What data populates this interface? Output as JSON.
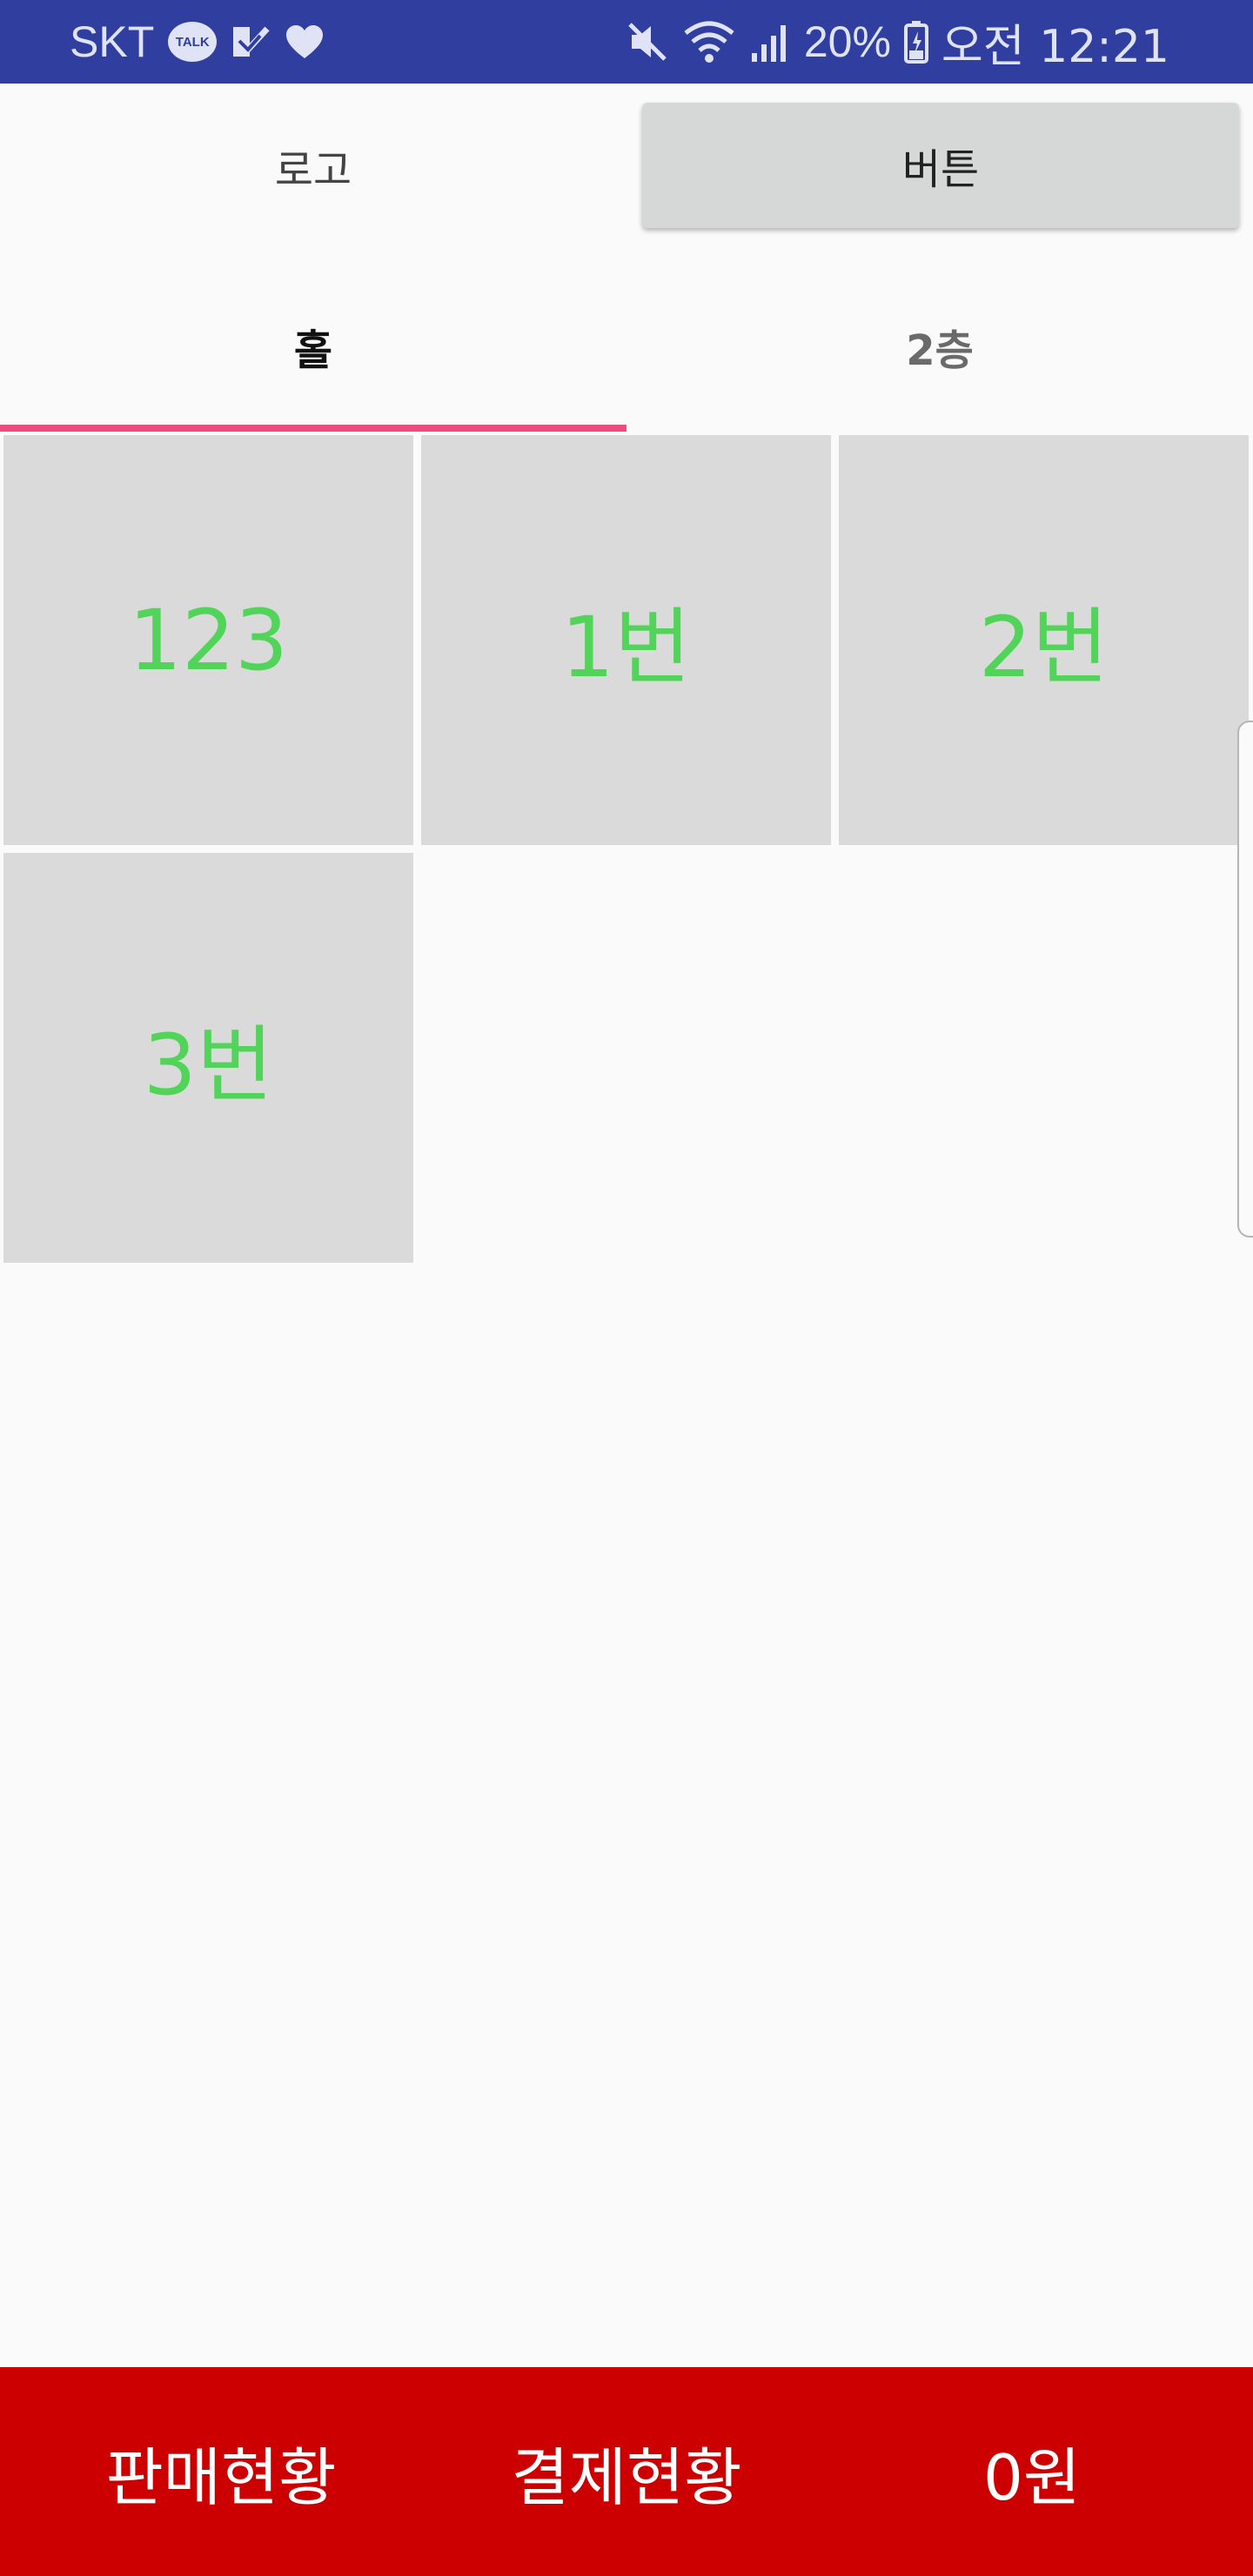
{
  "status_bar": {
    "carrier": "SKT",
    "talk_icon_text": "TALK",
    "battery": "20%",
    "time": "오전 12:21",
    "icons": [
      "kakaotalk-icon",
      "check-icon",
      "heart-icon",
      "mute-icon",
      "wifi-icon",
      "signal-icon",
      "battery-icon"
    ]
  },
  "header": {
    "logo_label": "로고",
    "button_label": "버튼"
  },
  "tabs": [
    {
      "label": "홀",
      "selected": true
    },
    {
      "label": "2층",
      "selected": false
    }
  ],
  "tables": [
    {
      "label": "123"
    },
    {
      "label": "1번"
    },
    {
      "label": "2번"
    },
    {
      "label": "3번"
    }
  ],
  "bottom_bar": {
    "sales_label": "판매현황",
    "payment_label": "결제현황",
    "total_label": "0원"
  },
  "colors": {
    "status_bar": "#303f9f",
    "tab_indicator": "#ee4b80",
    "table_text": "#52d45a",
    "table_bg": "#dadada",
    "bottom_bar": "#cc0000"
  }
}
